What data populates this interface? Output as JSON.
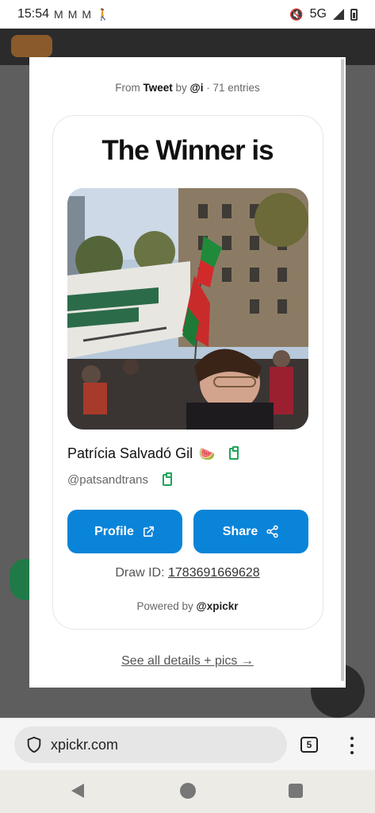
{
  "status_bar": {
    "time": "15:54",
    "notif_icons": [
      "gmail-icon",
      "gmail-icon",
      "gmail-icon",
      "walking-icon"
    ],
    "network": "5G",
    "right_icons": [
      "mute-icon",
      "signal-icon",
      "battery-icon"
    ]
  },
  "modal": {
    "source": {
      "prefix": "From",
      "platform": "Tweet",
      "by": "by",
      "author": "@i",
      "entries": "· 71 entries"
    },
    "title": "The Winner is",
    "winner": {
      "name": "Patrícia Salvadó Gil",
      "emoji": "🍉",
      "handle": "@patsandtrans"
    },
    "buttons": {
      "profile": "Profile",
      "share": "Share"
    },
    "draw_id": {
      "label": "Draw ID:",
      "value": "1783691669628"
    },
    "powered": {
      "prefix": "Powered by",
      "brand": "@xpickr"
    },
    "details_link": "See all details + pics →"
  },
  "browser": {
    "url": "xpickr.com",
    "tab_count": "5"
  },
  "colors": {
    "accent": "#0a84d8",
    "copy_green": "#1fa45a"
  }
}
